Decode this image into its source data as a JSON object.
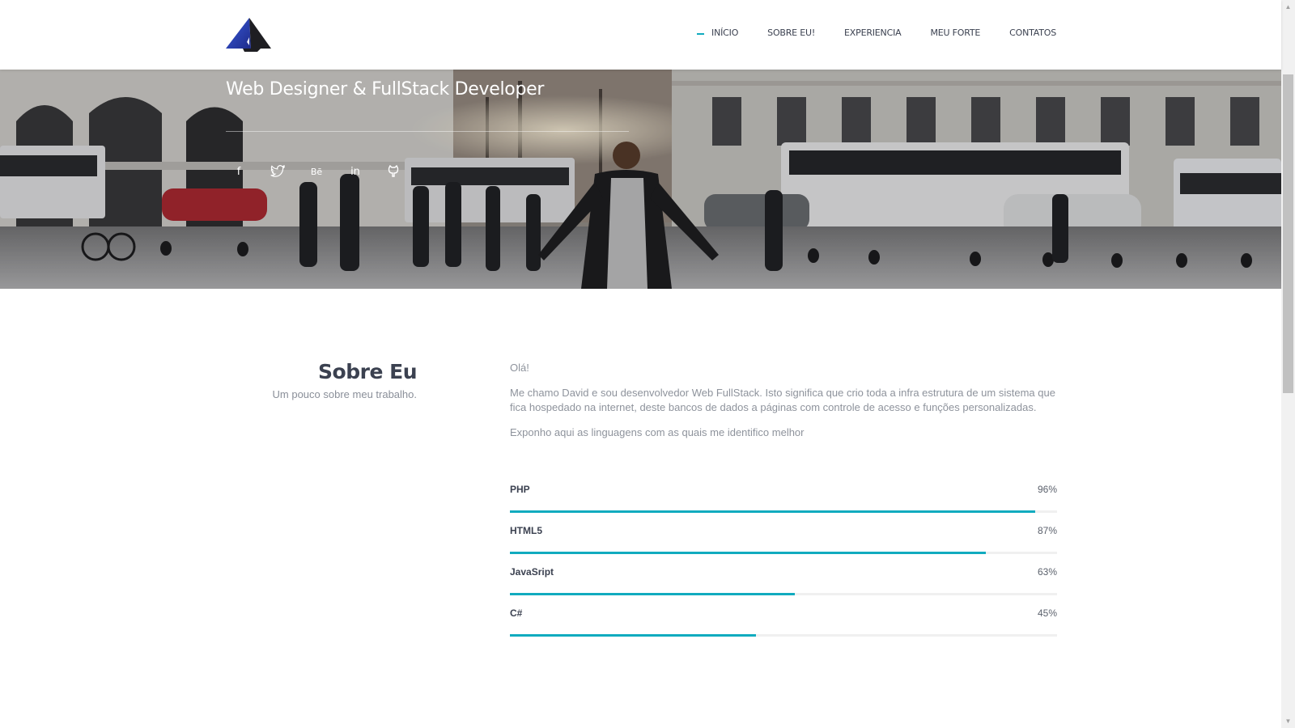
{
  "colors": {
    "accent": "#11abbf",
    "heading": "#3b4150",
    "body_text": "#8e939c"
  },
  "nav": {
    "items": [
      {
        "label": "INÍCIO",
        "active": true
      },
      {
        "label": "SOBRE EU!",
        "active": false
      },
      {
        "label": "EXPERIENCIA",
        "active": false
      },
      {
        "label": "MEU FORTE",
        "active": false
      },
      {
        "label": "CONTATOS",
        "active": false
      }
    ]
  },
  "hero": {
    "subtitle": "Web Designer & FullStack Developer",
    "social": [
      {
        "icon": "facebook-icon",
        "glyph": "f"
      },
      {
        "icon": "twitter-icon",
        "glyph": "t"
      },
      {
        "icon": "behance-icon",
        "glyph": "Bē"
      },
      {
        "icon": "linkedin-icon",
        "glyph": "in"
      },
      {
        "icon": "github-icon",
        "glyph": "◙"
      }
    ]
  },
  "about": {
    "title": "Sobre Eu",
    "subtitle": "Um pouco sobre meu trabalho.",
    "paragraphs": [
      "Olá!",
      "Me chamo David e sou desenvolvedor Web FullStack. Isto significa que crio toda a infra estrutura de um sistema que fica hospedado na internet, deste bancos de dados a páginas com controle de acesso e funções personalizadas.",
      "Exponho aqui as linguagens com as quais me identifico melhor"
    ],
    "skills": [
      {
        "name": "PHP",
        "percent_label": "96%",
        "fill": 0.96
      },
      {
        "name": "HTML5",
        "percent_label": "87%",
        "fill": 0.87
      },
      {
        "name": "JavaSript",
        "percent_label": "63%",
        "fill": 0.52
      },
      {
        "name": "C#",
        "percent_label": "45%",
        "fill": 0.45
      }
    ]
  }
}
